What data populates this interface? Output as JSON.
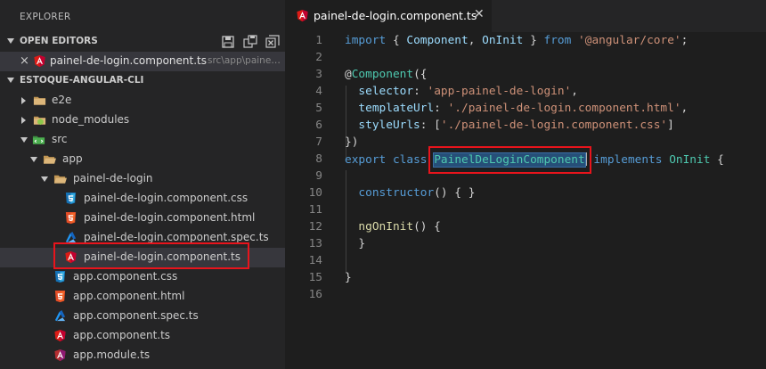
{
  "explorer": {
    "title": "EXPLORER",
    "open_editors": {
      "label": "OPEN EDITORS",
      "actions": [
        {
          "name": "save-icon"
        },
        {
          "name": "save-all-icon"
        },
        {
          "name": "close-all-icon"
        }
      ],
      "items": [
        {
          "close": "×",
          "name": "painel-de-login.component.ts",
          "path": "src\\app\\painel...",
          "icon": "angular-icon"
        }
      ]
    },
    "project": {
      "label": "ESTOQUE-ANGULAR-CLI",
      "tree": [
        {
          "label": "e2e",
          "icon": "folder-icon",
          "arrow": "closed"
        },
        {
          "label": "node_modules",
          "icon": "node-folder-icon",
          "arrow": "closed"
        },
        {
          "label": "src",
          "icon": "src-folder-icon",
          "arrow": "open"
        },
        {
          "label": "app",
          "icon": "folder-open-icon",
          "arrow": "open"
        },
        {
          "label": "painel-de-login",
          "icon": "folder-open-icon",
          "arrow": "open"
        },
        {
          "label": "painel-de-login.component.css",
          "icon": "css-icon"
        },
        {
          "label": "painel-de-login.component.html",
          "icon": "html-icon"
        },
        {
          "label": "painel-de-login.component.spec.ts",
          "icon": "spec-icon"
        },
        {
          "label": "painel-de-login.component.ts",
          "icon": "angular-icon",
          "selected": true
        },
        {
          "label": "app.component.css",
          "icon": "css-icon"
        },
        {
          "label": "app.component.html",
          "icon": "html-icon"
        },
        {
          "label": "app.component.spec.ts",
          "icon": "spec-icon"
        },
        {
          "label": "app.component.ts",
          "icon": "angular-icon"
        },
        {
          "label": "app.module.ts",
          "icon": "angular-module-icon"
        }
      ]
    }
  },
  "editor": {
    "tab": {
      "name": "painel-de-login.component.ts",
      "close": "✕",
      "icon": "angular-icon"
    },
    "line_numbers": [
      "1",
      "2",
      "3",
      "4",
      "5",
      "6",
      "7",
      "8",
      "9",
      "10",
      "11",
      "12",
      "13",
      "14",
      "15",
      "16"
    ],
    "code": {
      "l1_import": "import",
      "l1_open": " { ",
      "l1_component": "Component",
      "l1_comma": ", ",
      "l1_oninit": "OnInit",
      "l1_close": " } ",
      "l1_from": "from",
      "l1_space": " ",
      "l1_module": "'@angular/core'",
      "l1_semi": ";",
      "l3_at": "@",
      "l3_component": "Component",
      "l3_open": "({",
      "l4_indent": "  ",
      "l4_key": "selector",
      "l4_colon": ": ",
      "l4_value": "'app-painel-de-login'",
      "l4_comma": ",",
      "l5_indent": "  ",
      "l5_key": "templateUrl",
      "l5_colon": ": ",
      "l5_value": "'./painel-de-login.component.html'",
      "l5_comma": ",",
      "l6_indent": "  ",
      "l6_key": "styleUrls",
      "l6_colon": ": [",
      "l6_value": "'./painel-de-login.component.css'",
      "l6_close": "]",
      "l7_close": "})",
      "l8_export": "export",
      "l8_sp1": " ",
      "l8_class": "class",
      "l8_sp2": " ",
      "l8_name": "PainelDeLoginComponent",
      "l8_sp3": " ",
      "l8_implements": "implements",
      "l8_sp4": " ",
      "l8_oninit": "OnInit",
      "l8_brace": " {",
      "l10_indent": "  ",
      "l10_fn": "constructor",
      "l10_rest": "() { }",
      "l12_indent": "  ",
      "l12_fn": "ngOnInit",
      "l12_rest": "() {",
      "l13_close": "  }",
      "l15_close": "}"
    }
  },
  "colors": {
    "highlight_box": "#e8141c",
    "angular_red": "#dd1b16",
    "css_blue": "#1572b6",
    "html_orange": "#e44d26"
  }
}
